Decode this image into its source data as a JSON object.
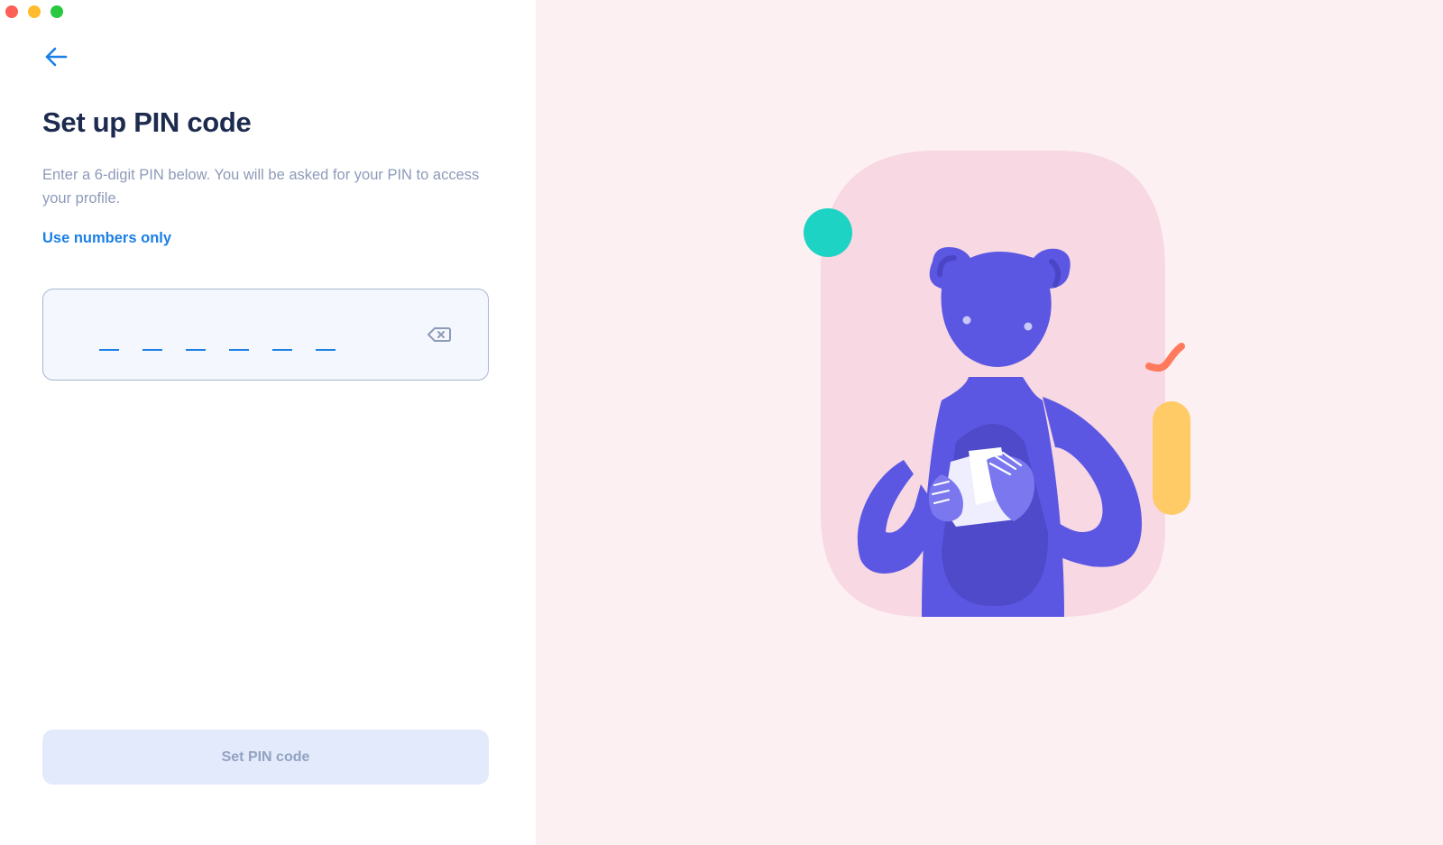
{
  "window": {
    "controls": [
      "close",
      "minimize",
      "maximize"
    ]
  },
  "header": {
    "back_icon": "arrow-left-icon"
  },
  "content": {
    "title": "Set up PIN code",
    "description": "Enter a 6-digit PIN below. You will be asked for your PIN to access your profile.",
    "hint": "Use numbers only"
  },
  "pin_input": {
    "digit_count": 6,
    "value": "",
    "clear_icon": "backspace-icon"
  },
  "actions": {
    "submit_label": "Set PIN code"
  },
  "colors": {
    "accent": "#1a7fe6",
    "title": "#1d2b4f",
    "muted_text": "#8d9bb8",
    "illustration_bg": "#fdf0f3",
    "character": "#5b57e3"
  }
}
